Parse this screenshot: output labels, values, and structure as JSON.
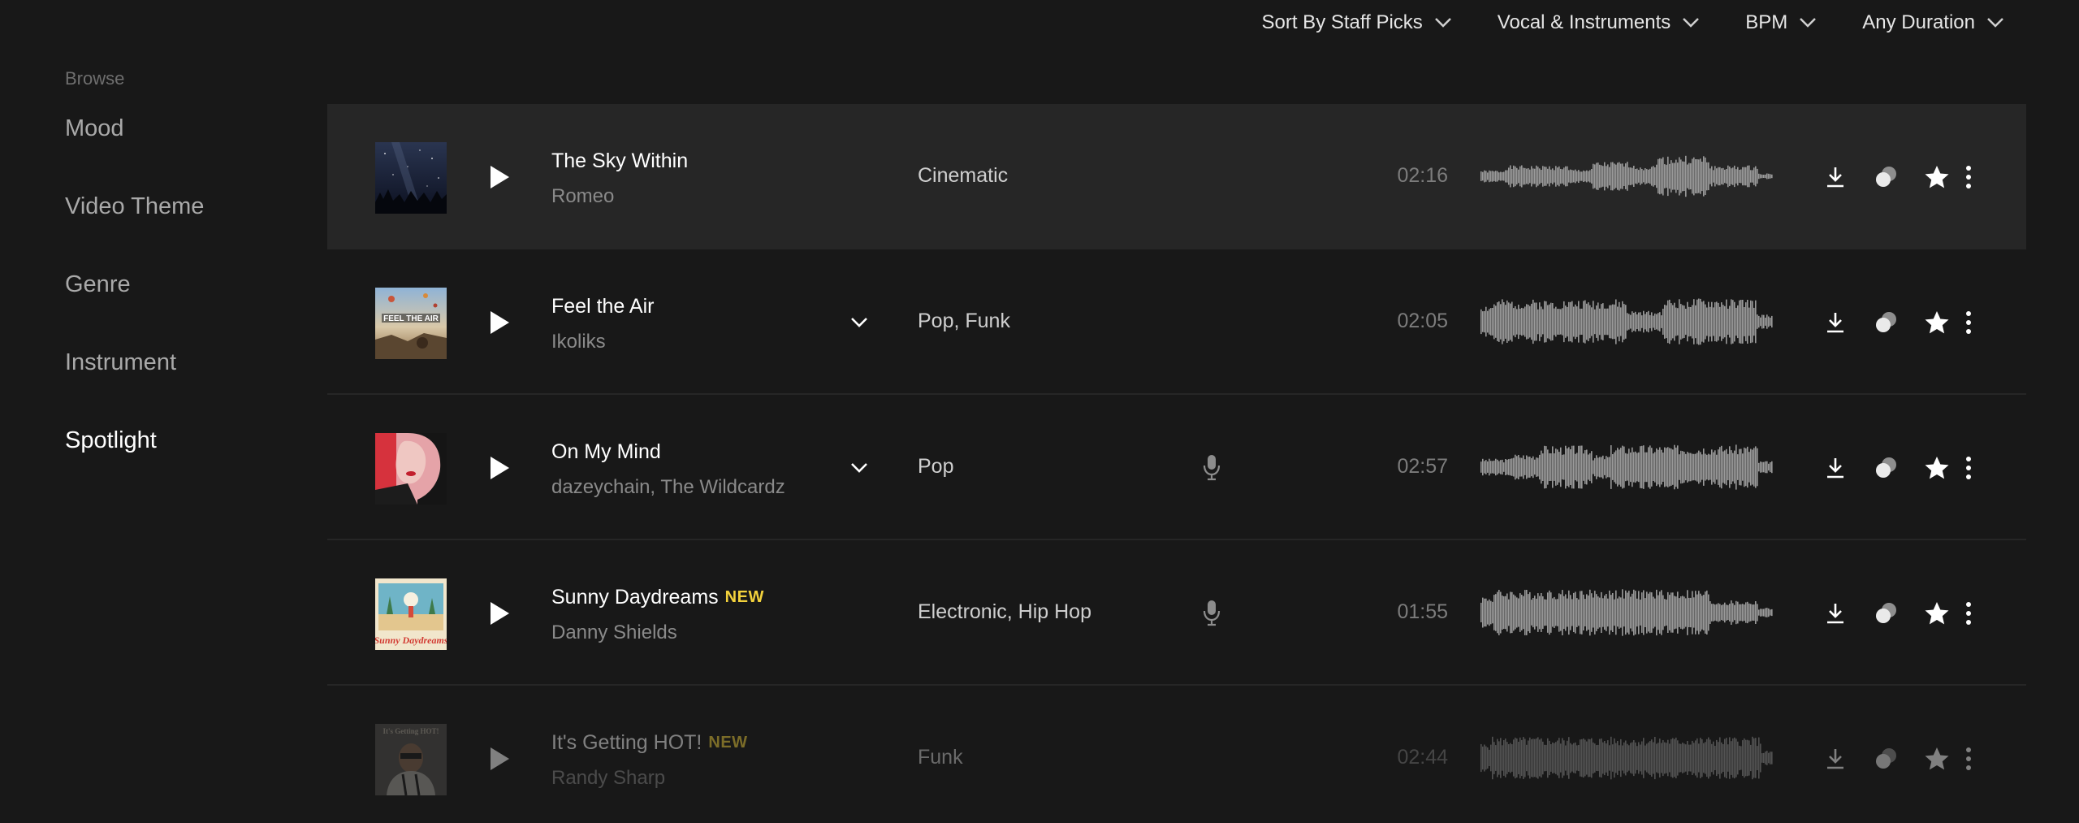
{
  "filters": [
    {
      "label": "Sort By Staff Picks"
    },
    {
      "label": "Vocal & Instruments"
    },
    {
      "label": "BPM"
    },
    {
      "label": "Any Duration"
    }
  ],
  "sidebar": {
    "heading": "Browse",
    "items": [
      {
        "label": "Mood",
        "active": false
      },
      {
        "label": "Video Theme",
        "active": false
      },
      {
        "label": "Genre",
        "active": false
      },
      {
        "label": "Instrument",
        "active": false
      },
      {
        "label": "Spotlight",
        "active": true
      }
    ]
  },
  "tracks": [
    {
      "title": "The Sky Within",
      "artist": "Romeo",
      "genre": "Cinematic",
      "duration": "02:16",
      "new_label": "",
      "has_vocals": false,
      "expandable": false,
      "art": "starry-night"
    },
    {
      "title": "Feel the Air",
      "artist": "Ikoliks",
      "genre": "Pop, Funk",
      "duration": "02:05",
      "new_label": "",
      "has_vocals": false,
      "expandable": true,
      "art": "balloons-landscape"
    },
    {
      "title": "On My Mind",
      "artist": "dazeychain, The Wildcardz",
      "genre": "Pop",
      "duration": "02:57",
      "new_label": "",
      "has_vocals": true,
      "expandable": true,
      "art": "red-portrait"
    },
    {
      "title": "Sunny Daydreams",
      "artist": "Danny Shields",
      "genre": "Electronic, Hip Hop",
      "duration": "01:55",
      "new_label": "NEW",
      "has_vocals": true,
      "expandable": false,
      "art": "beach-poster"
    },
    {
      "title": "It's Getting HOT!",
      "artist": "Randy Sharp",
      "genre": "Funk",
      "duration": "02:44",
      "new_label": "NEW",
      "has_vocals": false,
      "expandable": false,
      "art": "man-portrait"
    }
  ],
  "icons": {
    "filter_chevron": "chevron-down-icon",
    "play": "play-icon",
    "expand": "chevron-down-icon",
    "vocals": "microphone-icon",
    "download": "download-icon",
    "stems": "stems-icon",
    "favorite": "star-icon",
    "more": "more-vertical-icon"
  },
  "colors": {
    "background": "#181818",
    "highlight_row": "#262626",
    "new_badge": "#f3d23c",
    "waveform": "#9a9a9a"
  }
}
